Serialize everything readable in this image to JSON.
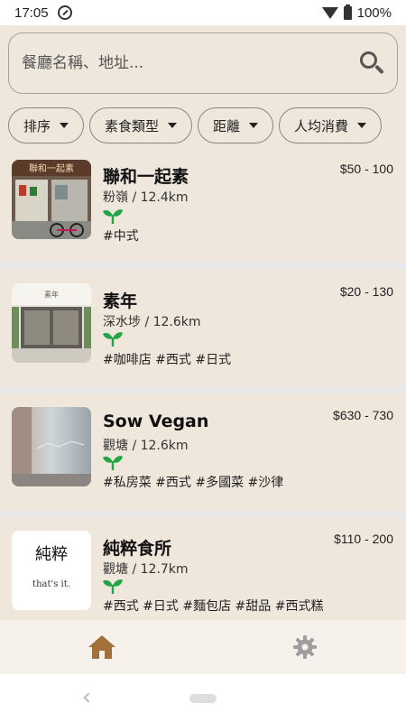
{
  "status_bar": {
    "time": "17:05",
    "battery": "100%"
  },
  "search": {
    "placeholder": "餐廳名稱、地址..."
  },
  "filters": [
    {
      "label": "排序"
    },
    {
      "label": "素食類型"
    },
    {
      "label": "距離"
    },
    {
      "label": "人均消費"
    }
  ],
  "restaurants": [
    {
      "name": "聯和一起素",
      "location": "粉嶺 / 12.4km",
      "price": "$50 - 100",
      "tags": "#中式",
      "photo_sign": "聯和一起素"
    },
    {
      "name": "素年",
      "location": "深水埗 / 12.6km",
      "price": "$20 - 130",
      "tags": "#咖啡店 #西式 #日式",
      "photo_sign": "素年"
    },
    {
      "name": "Sow Vegan",
      "location": "觀塘 / 12.6km",
      "price": "$630 - 730",
      "tags": "#私房菜 #西式 #多國菜 #沙律"
    },
    {
      "name": "純粹食所",
      "location": "觀塘 / 12.7km",
      "price": "$110 - 200",
      "tags": "#西式 #日式 #麵包店 #甜品 #西式糕點",
      "logo": {
        "main": "純粹",
        "sub": "that's it."
      }
    }
  ],
  "icons": {
    "vegan": "sprout-icon",
    "nav_home": "home-icon",
    "nav_settings": "gear-icon"
  },
  "colors": {
    "background": "#efe6dc",
    "accent": "#a4703a",
    "sprout": "#21a545",
    "nav_inactive": "#9e9e9e"
  }
}
